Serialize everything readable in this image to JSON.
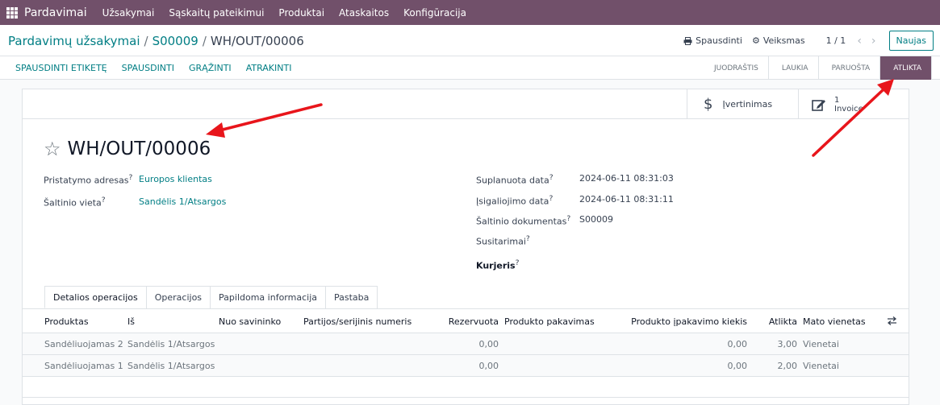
{
  "topnav": {
    "brand": "Pardavimai",
    "items": [
      "Užsakymai",
      "Sąskaitų pateikimui",
      "Produktai",
      "Ataskaitos",
      "Konfigūracija"
    ]
  },
  "breadcrumb": {
    "items": [
      "Pardavimų užsakymai",
      "S00009"
    ],
    "current": "WH/OUT/00006"
  },
  "toolbar": {
    "print_label": "Spausdinti",
    "action_label": "Veiksmas",
    "pager": "1 / 1",
    "new_label": "Naujas"
  },
  "actions": [
    "SPAUSDINTI ETIKETĘ",
    "SPAUSDINTI",
    "GRĄŽINTI",
    "ATRAKINTI"
  ],
  "statusbar": {
    "stages": [
      "JUODRAŠTIS",
      "LAUKIA",
      "PARUOŠTA",
      "ATLIKTA"
    ],
    "active": "ATLIKTA"
  },
  "smart_buttons": {
    "valuation": "Įvertinimas",
    "invoice_count": "1",
    "invoice_label": "Invoice"
  },
  "record": {
    "name": "WH/OUT/00006"
  },
  "fields": {
    "delivery_address_label": "Pristatymo adresas",
    "delivery_address_value": "Europos klientas",
    "source_location_label": "Šaltinio vieta",
    "source_location_value": "Sandėlis 1/Atsargos",
    "scheduled_label": "Suplanuota data",
    "scheduled_value": "2024-06-11 08:31:03",
    "effective_label": "Įsigaliojimo data",
    "effective_value": "2024-06-11 08:31:11",
    "source_doc_label": "Šaltinio dokumentas",
    "source_doc_value": "S00009",
    "agreement_label": "Susitarimai",
    "carrier_label": "Kurjeris",
    "help_mark": "?"
  },
  "tabs": [
    "Detalios operacijos",
    "Operacijos",
    "Papildoma informacija",
    "Pastaba"
  ],
  "table": {
    "headers": [
      "Produktas",
      "Iš",
      "Nuo savininko",
      "Partijos/serijinis numeris",
      "Rezervuota",
      "Produkto pakavimas",
      "Produkto įpakavimo kiekis",
      "Atlikta",
      "Mato vienetas"
    ],
    "rows": [
      {
        "product": "Sandėliuojamas 2",
        "from": "Sandėlis 1/Atsargos",
        "reserved": "0,00",
        "pack_qty": "0,00",
        "done": "3,00",
        "uom": "Vienetai"
      },
      {
        "product": "Sandėliuojamas 1",
        "from": "Sandėlis 1/Atsargos",
        "reserved": "0,00",
        "pack_qty": "0,00",
        "done": "2,00",
        "uom": "Vienetai"
      }
    ]
  },
  "colors": {
    "brand": "#71506a",
    "link": "#017e84",
    "annotation": "#e8151b"
  }
}
